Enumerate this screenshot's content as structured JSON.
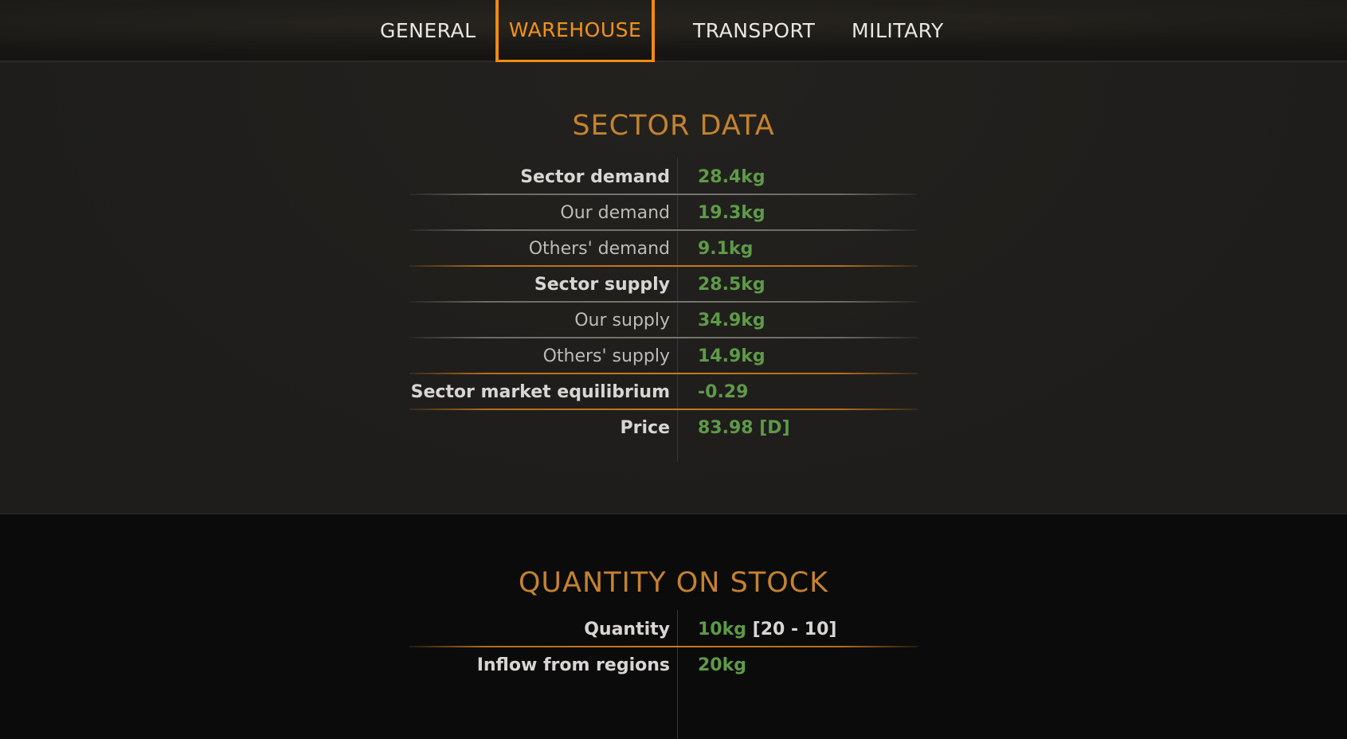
{
  "tabs": {
    "general": "GENERAL",
    "warehouse": "WAREHOUSE",
    "transport": "TRANSPORT",
    "military": "MILITARY",
    "active": "warehouse"
  },
  "colors": {
    "accent_orange": "#f08a12",
    "title_orange": "#c4822f",
    "value_green": "#5e9a48"
  },
  "sector_data": {
    "title": "SECTOR DATA",
    "rows": [
      {
        "label": "Sector demand",
        "value": "28.4kg"
      },
      {
        "label": "Our demand",
        "value": "19.3kg"
      },
      {
        "label": "Others' demand",
        "value": "9.1kg"
      },
      {
        "label": "Sector supply",
        "value": "28.5kg"
      },
      {
        "label": "Our supply",
        "value": "34.9kg"
      },
      {
        "label": "Others' supply",
        "value": "14.9kg"
      },
      {
        "label": "Sector market equilibrium",
        "value": "-0.29"
      },
      {
        "label": "Price",
        "value": "83.98 [D]"
      }
    ]
  },
  "stock": {
    "title": "QUANTITY ON STOCK",
    "rows": [
      {
        "label": "Quantity",
        "value": "10kg",
        "range": "[20 - 10]"
      },
      {
        "label": "Inflow from regions",
        "value": "20kg"
      }
    ]
  }
}
